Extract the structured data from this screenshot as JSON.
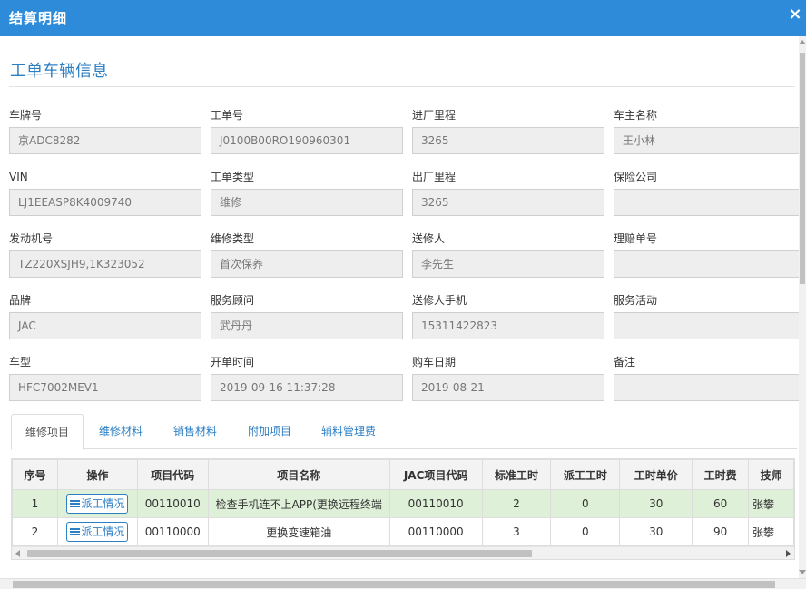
{
  "dialog": {
    "title": "结算明细",
    "close_glyph": "×",
    "close_icon": "close-icon"
  },
  "section": {
    "title": "工单车辆信息"
  },
  "fields": [
    {
      "label": "车牌号",
      "value": "京ADC8282"
    },
    {
      "label": "工单号",
      "value": "J0100B00RO190960301"
    },
    {
      "label": "进厂里程",
      "value": "3265"
    },
    {
      "label": "车主名称",
      "value": "王小林"
    },
    {
      "label": "VIN",
      "value": "LJ1EEASP8K4009740"
    },
    {
      "label": "工单类型",
      "value": "维修"
    },
    {
      "label": "出厂里程",
      "value": "3265"
    },
    {
      "label": "保险公司",
      "value": ""
    },
    {
      "label": "发动机号",
      "value": "TZ220XSJH9,1K323052"
    },
    {
      "label": "维修类型",
      "value": "首次保养"
    },
    {
      "label": "送修人",
      "value": "李先生"
    },
    {
      "label": "理赔单号",
      "value": ""
    },
    {
      "label": "品牌",
      "value": "JAC"
    },
    {
      "label": "服务顾问",
      "value": "武丹丹"
    },
    {
      "label": "送修人手机",
      "value": "15311422823"
    },
    {
      "label": "服务活动",
      "value": ""
    },
    {
      "label": "车型",
      "value": "HFC7002MEV1"
    },
    {
      "label": "开单时间",
      "value": "2019-09-16 11:37:28"
    },
    {
      "label": "购车日期",
      "value": "2019-08-21"
    },
    {
      "label": "备注",
      "value": ""
    }
  ],
  "tabs": [
    {
      "label": "维修项目",
      "active": true
    },
    {
      "label": "维修材料",
      "active": false
    },
    {
      "label": "销售材料",
      "active": false
    },
    {
      "label": "附加项目",
      "active": false
    },
    {
      "label": "辅料管理费",
      "active": false
    }
  ],
  "grid": {
    "columns": [
      "序号",
      "操作",
      "项目代码",
      "项目名称",
      "JAC项目代码",
      "标准工时",
      "派工工时",
      "工时单价",
      "工时费",
      "技师"
    ],
    "rows": [
      {
        "selected": true,
        "cells": [
          "1",
          "派工情况",
          "00110010",
          "检查手机连不上APP(更换远程终端",
          "00110010",
          "2",
          "0",
          "30",
          "60",
          "张攀"
        ]
      },
      {
        "selected": false,
        "cells": [
          "2",
          "派工情况",
          "00110000",
          "更换变速箱油",
          "00110000",
          "3",
          "0",
          "30",
          "90",
          "张攀"
        ]
      }
    ]
  },
  "colors": {
    "title_bar": "#2d8bd9",
    "accent": "#2d7fc4",
    "selected_row": "#dff0d8"
  }
}
